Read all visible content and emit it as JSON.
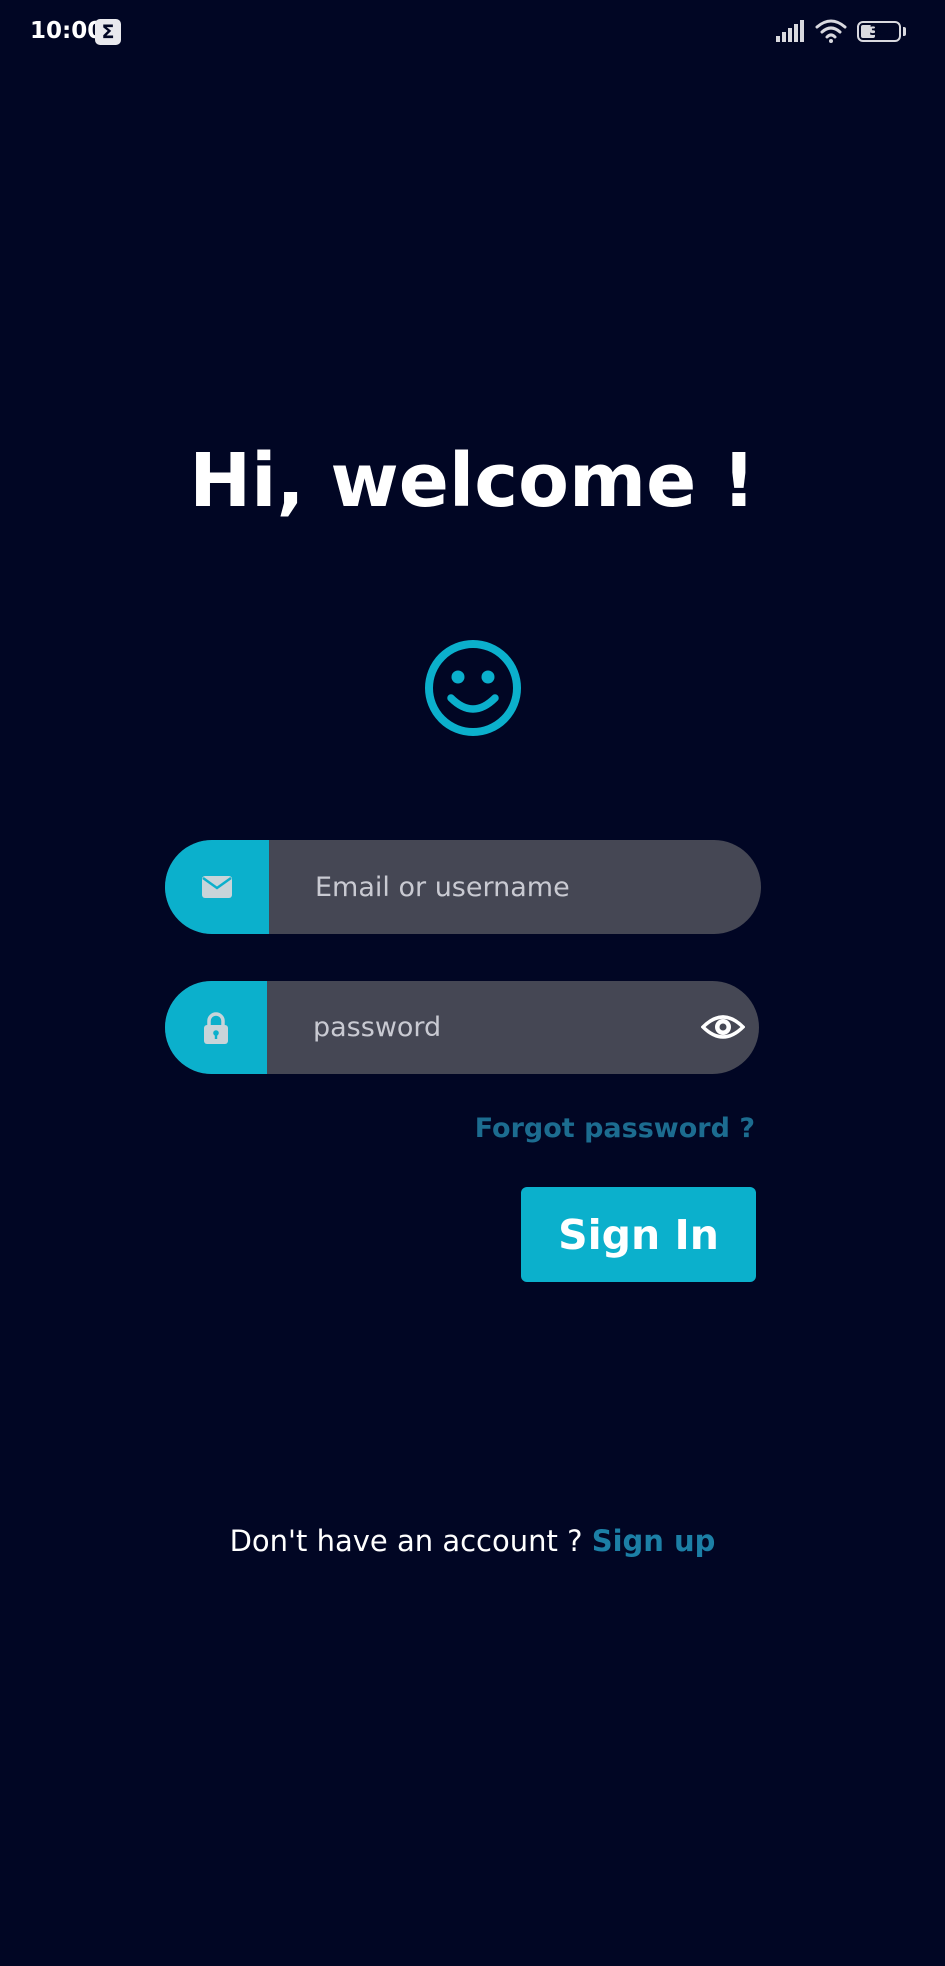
{
  "status_bar": {
    "time": "10:00",
    "notification_glyph": "Σ",
    "battery_level": "39",
    "battery_fraction": 0.39,
    "icons": [
      "signal-icon",
      "wifi-icon",
      "battery-icon"
    ]
  },
  "header": {
    "title": "Hi, welcome !",
    "icon": "smiley-icon"
  },
  "login_form": {
    "email": {
      "placeholder": "Email or username",
      "value": "",
      "icon": "envelope-icon"
    },
    "password": {
      "placeholder": "password",
      "value": "",
      "icon": "lock-icon",
      "toggle_icon": "eye-icon"
    },
    "forgot_label": "Forgot password ?",
    "submit_label": "Sign In"
  },
  "footer": {
    "prompt": "Don't have an account ? ",
    "signup_label": "Sign up"
  },
  "colors": {
    "background": "#010624",
    "accent": "#0bb0cc",
    "field": "#454754",
    "link": "#1c6c90"
  }
}
